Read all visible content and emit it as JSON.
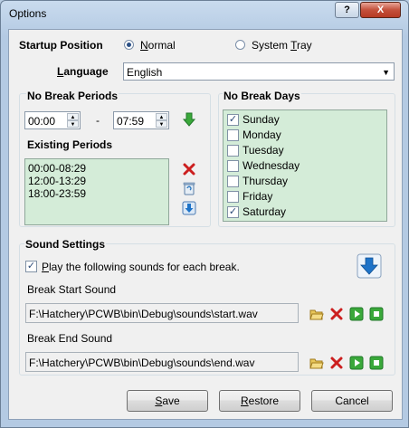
{
  "window": {
    "title": "Options",
    "help_glyph": "?",
    "close_glyph": "X"
  },
  "startup": {
    "label": "Startup Position",
    "options": [
      {
        "label_pre": "",
        "label_key": "N",
        "label_post": "ormal",
        "selected": true
      },
      {
        "label_pre": "System ",
        "label_key": "T",
        "label_post": "ray",
        "selected": false
      }
    ]
  },
  "language": {
    "label_pre": "",
    "label_key": "L",
    "label_post": "anguage",
    "value": "English",
    "arrow": "▼"
  },
  "no_break_periods": {
    "title": "No Break Periods",
    "start": "00:00",
    "end": "07:59",
    "separator": "-",
    "spin_up": "▲",
    "spin_down": "▼",
    "existing_title": "Existing Periods",
    "existing": [
      "00:00-08:29",
      "12:00-13:29",
      "18:00-23:59"
    ]
  },
  "no_break_days": {
    "title": "No Break Days",
    "days": [
      {
        "label": "Sunday",
        "checked": true
      },
      {
        "label": "Monday",
        "checked": false
      },
      {
        "label": "Tuesday",
        "checked": false
      },
      {
        "label": "Wednesday",
        "checked": false
      },
      {
        "label": "Thursday",
        "checked": false
      },
      {
        "label": "Friday",
        "checked": false
      },
      {
        "label": "Saturday",
        "checked": true
      }
    ]
  },
  "sound": {
    "title": "Sound Settings",
    "play_pre": "",
    "play_key": "P",
    "play_post": "lay the following sounds for each break.",
    "play_checked": true,
    "start_label": "Break Start Sound",
    "start_path": "F:\\Hatchery\\PCWB\\bin\\Debug\\sounds\\start.wav",
    "end_label": "Break End Sound",
    "end_path": "F:\\Hatchery\\PCWB\\bin\\Debug\\sounds\\end.wav"
  },
  "buttons": {
    "save_key": "S",
    "save_post": "ave",
    "restore_pre": "",
    "restore_key": "R",
    "restore_post": "estore",
    "cancel": "Cancel"
  },
  "colors": {
    "list_bg": "#d4ecd8",
    "delete_red": "#cc1f1f",
    "play_green": "#3aa83a",
    "blue_arrow": "#1e73c8"
  }
}
